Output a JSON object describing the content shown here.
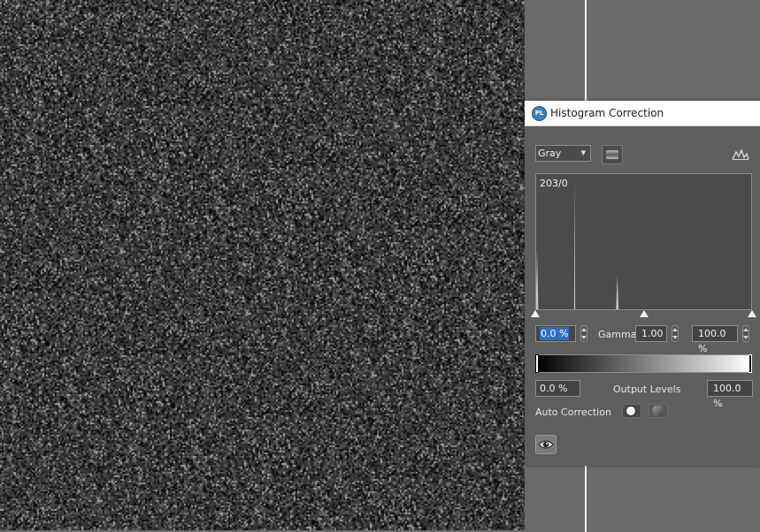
{
  "image": {
    "name": "random gray noise"
  },
  "panel": {
    "title": "Histogram Correction",
    "logo_text": "PL",
    "logo_icon": "photoline-logo-icon"
  },
  "channel": {
    "selected": "Gray",
    "mode_icon": "channel-mode-icon",
    "histogram_view_icon": "histogram-curve-icon"
  },
  "histogram": {
    "readout": "203/0",
    "peaks": [
      {
        "level": 0,
        "relative_height": 0.45
      },
      {
        "level": 45,
        "relative_height": 1.0
      },
      {
        "level": 96,
        "relative_height": 0.25
      }
    ],
    "input_slider_levels": {
      "black": 0,
      "gamma": 0.5,
      "white": 1
    }
  },
  "input": {
    "black_value": "0.0 %",
    "gamma_label": "Gamma:",
    "gamma_value": "1.00",
    "white_value": "100.0 %"
  },
  "output": {
    "black_value": "0.0 %",
    "label": "Output Levels",
    "white_value": "100.0 %"
  },
  "auto_correction": {
    "label": "Auto Correction"
  },
  "preview": {
    "icon": "eye-icon"
  },
  "colors": {
    "panel_bg": "#5e5e5e",
    "selection": "#2d6fc8",
    "canvas_bg": "#6a6a6a"
  }
}
